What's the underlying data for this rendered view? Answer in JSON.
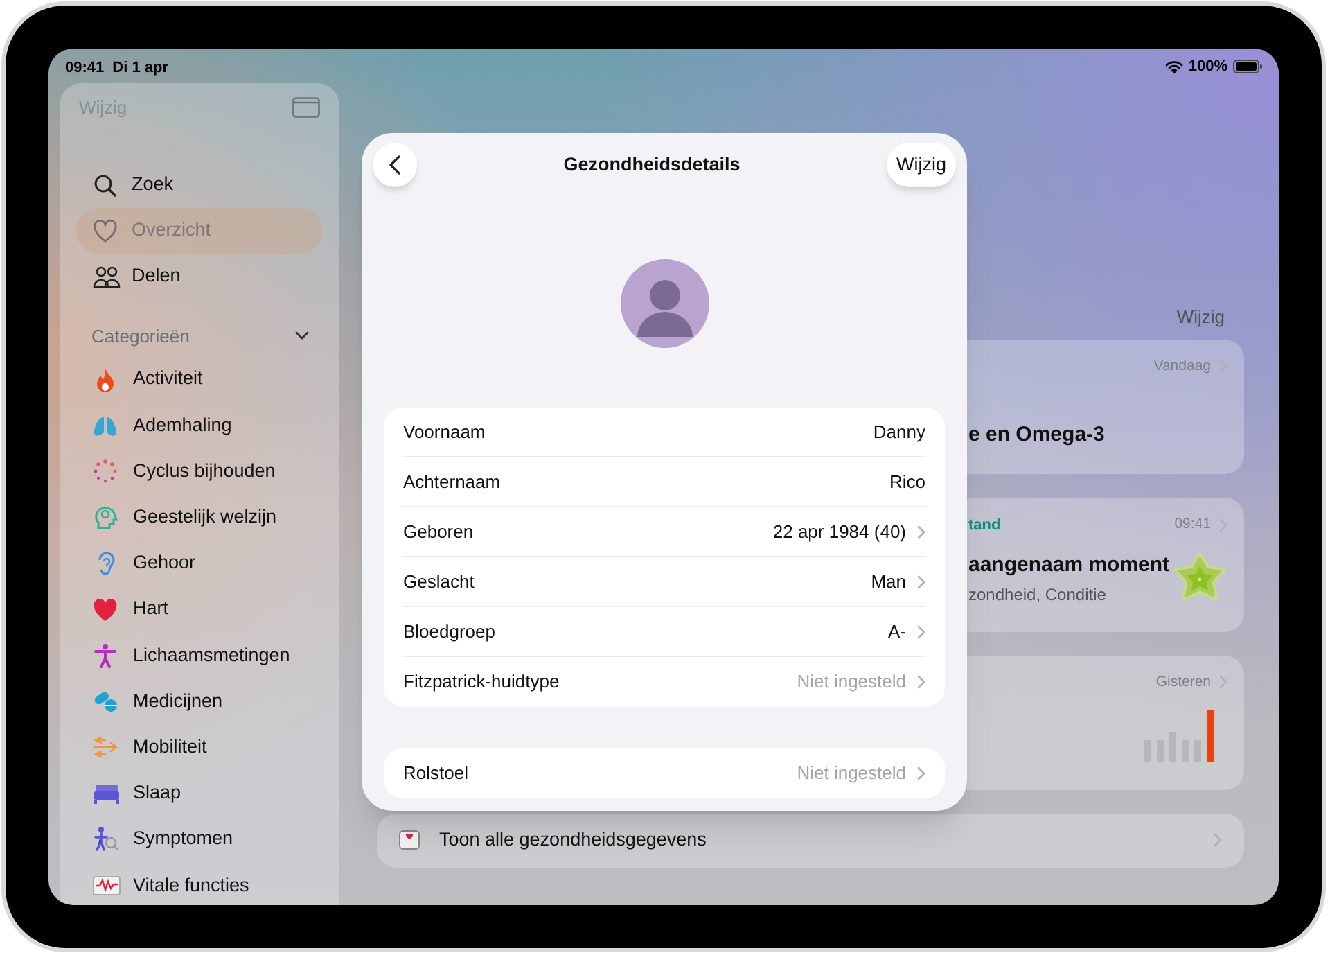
{
  "status_bar": {
    "time": "09:41",
    "date": "Di 1 apr",
    "battery": "100%"
  },
  "sidebar": {
    "edit": "Wijzig",
    "nav": [
      {
        "label": "Zoek",
        "selected": false
      },
      {
        "label": "Overzicht",
        "selected": true
      },
      {
        "label": "Delen",
        "selected": false
      }
    ],
    "section": {
      "title": "Categorieën",
      "expanded": true
    },
    "categories": [
      {
        "label": "Activiteit"
      },
      {
        "label": "Ademhaling"
      },
      {
        "label": "Cyclus bijhouden"
      },
      {
        "label": "Geestelijk welzijn"
      },
      {
        "label": "Gehoor"
      },
      {
        "label": "Hart"
      },
      {
        "label": "Lichaamsmetingen"
      },
      {
        "label": "Medicijnen"
      },
      {
        "label": "Mobiliteit"
      },
      {
        "label": "Slaap"
      },
      {
        "label": "Symptomen"
      },
      {
        "label": "Vitale functies"
      }
    ]
  },
  "main": {
    "edit": "Wijzig",
    "cards": [
      {
        "kind": "text",
        "time": "Vandaag",
        "title": "e en Omega-3"
      },
      {
        "kind": "mood",
        "category": "tand",
        "time": "09:41",
        "title": "aangenaam moment",
        "subtitle": "zondheid, Conditie"
      },
      {
        "kind": "bars",
        "time": "Gisteren"
      }
    ],
    "show_all": "Toon alle gezondheidsgegevens"
  },
  "sheet": {
    "title": "Gezondheidsdetails",
    "edit": "Wijzig",
    "groups": [
      [
        {
          "label": "Voornaam",
          "value": "Danny",
          "muted": false,
          "chevron": false
        },
        {
          "label": "Achternaam",
          "value": "Rico",
          "muted": false,
          "chevron": false
        },
        {
          "label": "Geboren",
          "value": "22 apr 1984 (40)",
          "muted": false,
          "chevron": true
        },
        {
          "label": "Geslacht",
          "value": "Man",
          "muted": false,
          "chevron": true
        },
        {
          "label": "Bloedgroep",
          "value": "A-",
          "muted": false,
          "chevron": true
        },
        {
          "label": "Fitzpatrick-huidtype",
          "value": "Niet ingesteld",
          "muted": true,
          "chevron": true
        }
      ],
      [
        {
          "label": "Rolstoel",
          "value": "Niet ingesteld",
          "muted": true,
          "chevron": true
        }
      ]
    ]
  }
}
